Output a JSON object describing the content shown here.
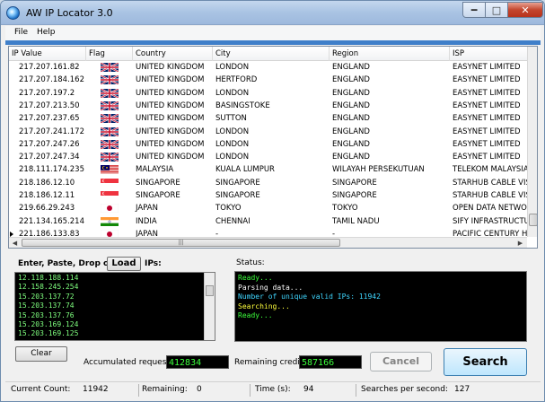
{
  "window": {
    "title": "AW IP Locator 3.0"
  },
  "menu": {
    "file": "File",
    "help": "Help"
  },
  "table": {
    "columns": [
      "IP Value",
      "Flag",
      "Country",
      "City",
      "Region",
      "ISP"
    ],
    "rows": [
      {
        "ip": "217.207.161.82",
        "flag": "uk",
        "country": "UNITED KINGDOM",
        "city": "LONDON",
        "region": "ENGLAND",
        "isp": "EASYNET LIMITED"
      },
      {
        "ip": "217.207.184.162",
        "flag": "uk",
        "country": "UNITED KINGDOM",
        "city": "HERTFORD",
        "region": "ENGLAND",
        "isp": "EASYNET LIMITED"
      },
      {
        "ip": "217.207.197.2",
        "flag": "uk",
        "country": "UNITED KINGDOM",
        "city": "LONDON",
        "region": "ENGLAND",
        "isp": "EASYNET LIMITED"
      },
      {
        "ip": "217.207.213.50",
        "flag": "uk",
        "country": "UNITED KINGDOM",
        "city": "BASINGSTOKE",
        "region": "ENGLAND",
        "isp": "EASYNET LIMITED"
      },
      {
        "ip": "217.207.237.65",
        "flag": "uk",
        "country": "UNITED KINGDOM",
        "city": "SUTTON",
        "region": "ENGLAND",
        "isp": "EASYNET LIMITED"
      },
      {
        "ip": "217.207.241.172",
        "flag": "uk",
        "country": "UNITED KINGDOM",
        "city": "LONDON",
        "region": "ENGLAND",
        "isp": "EASYNET LIMITED"
      },
      {
        "ip": "217.207.247.26",
        "flag": "uk",
        "country": "UNITED KINGDOM",
        "city": "LONDON",
        "region": "ENGLAND",
        "isp": "EASYNET LIMITED"
      },
      {
        "ip": "217.207.247.34",
        "flag": "uk",
        "country": "UNITED KINGDOM",
        "city": "LONDON",
        "region": "ENGLAND",
        "isp": "EASYNET LIMITED"
      },
      {
        "ip": "218.111.174.235",
        "flag": "my",
        "country": "MALAYSIA",
        "city": "KUALA LUMPUR",
        "region": "WILAYAH PERSEKUTUAN",
        "isp": "TELEKOM MALAYSIA B"
      },
      {
        "ip": "218.186.12.10",
        "flag": "sg",
        "country": "SINGAPORE",
        "city": "SINGAPORE",
        "region": "SINGAPORE",
        "isp": "STARHUB CABLE VISI"
      },
      {
        "ip": "218.186.12.11",
        "flag": "sg",
        "country": "SINGAPORE",
        "city": "SINGAPORE",
        "region": "SINGAPORE",
        "isp": "STARHUB CABLE VISI"
      },
      {
        "ip": "219.66.29.243",
        "flag": "jp",
        "country": "JAPAN",
        "city": "TOKYO",
        "region": "TOKYO",
        "isp": "OPEN DATA NETWOR"
      },
      {
        "ip": "221.134.165.214",
        "flag": "in",
        "country": "INDIA",
        "city": "CHENNAI",
        "region": "TAMIL NADU",
        "isp": "SIFY INFRASTRUCTU"
      },
      {
        "ip": "221.186.133.83",
        "flag": "jp",
        "country": "JAPAN",
        "city": "-",
        "region": "-",
        "isp": "PACIFIC CENTURY H"
      }
    ]
  },
  "input": {
    "label_prefix": "Enter, Paste, Drop or",
    "load_label": "Load",
    "label_suffix": "IPs:",
    "lines": [
      "12.118.188.114",
      "12.158.245.254",
      "15.203.137.72",
      "15.203.137.74",
      "15.203.137.76",
      "15.203.169.124",
      "15.203.169.125"
    ]
  },
  "status": {
    "label": "Status:",
    "lines": [
      {
        "text": "Ready...",
        "color": "#3cff3c"
      },
      {
        "text": "Parsing data...",
        "color": "#ffffff"
      },
      {
        "text": "Number of unique valid IPs: 11942",
        "color": "#3fd6ff"
      },
      {
        "text": "Searching...",
        "color": "#ffff3c"
      },
      {
        "text": "Ready...",
        "color": "#3cff3c"
      }
    ]
  },
  "controls": {
    "clear": "Clear",
    "accumulated_label": "Accumulated requests:",
    "accumulated_value": "412834",
    "credit_label": "Remaining credit:",
    "credit_value": "587166",
    "cancel": "Cancel",
    "search": "Search"
  },
  "statusbar": {
    "current_count_label": "Current Count:",
    "current_count": "11942",
    "remaining_label": "Remaining:",
    "remaining": "0",
    "time_label": "Time (s):",
    "time": "94",
    "sps_label": "Searches per second:",
    "sps": "127"
  }
}
